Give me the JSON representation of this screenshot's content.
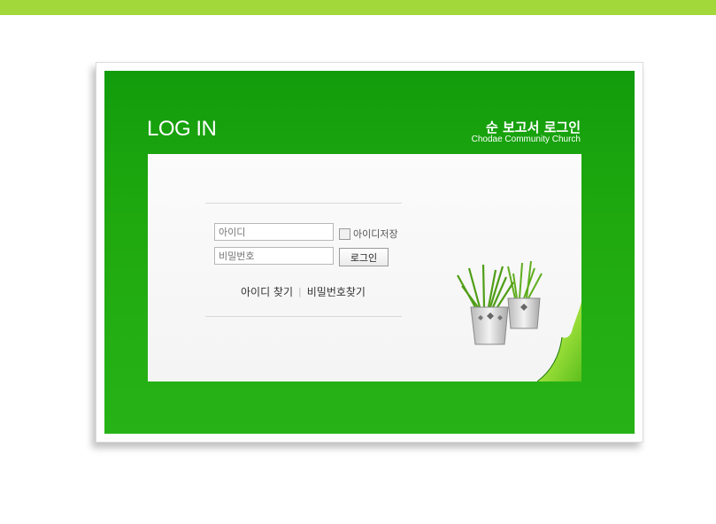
{
  "header": {
    "login_heading": "LOG IN",
    "title_kr": "순 보고서 로그인",
    "title_en": "Chodae Community Church"
  },
  "form": {
    "id_placeholder": "아이디",
    "pw_placeholder": "비밀번호",
    "remember_label": "아이디저장",
    "login_button": "로그인"
  },
  "links": {
    "find_id": "아이디 찾기",
    "separator": "|",
    "find_pw": "비밀번호찾기"
  },
  "colors": {
    "accent_bar": "#a2d83a",
    "panel_green": "#1fa90f"
  }
}
